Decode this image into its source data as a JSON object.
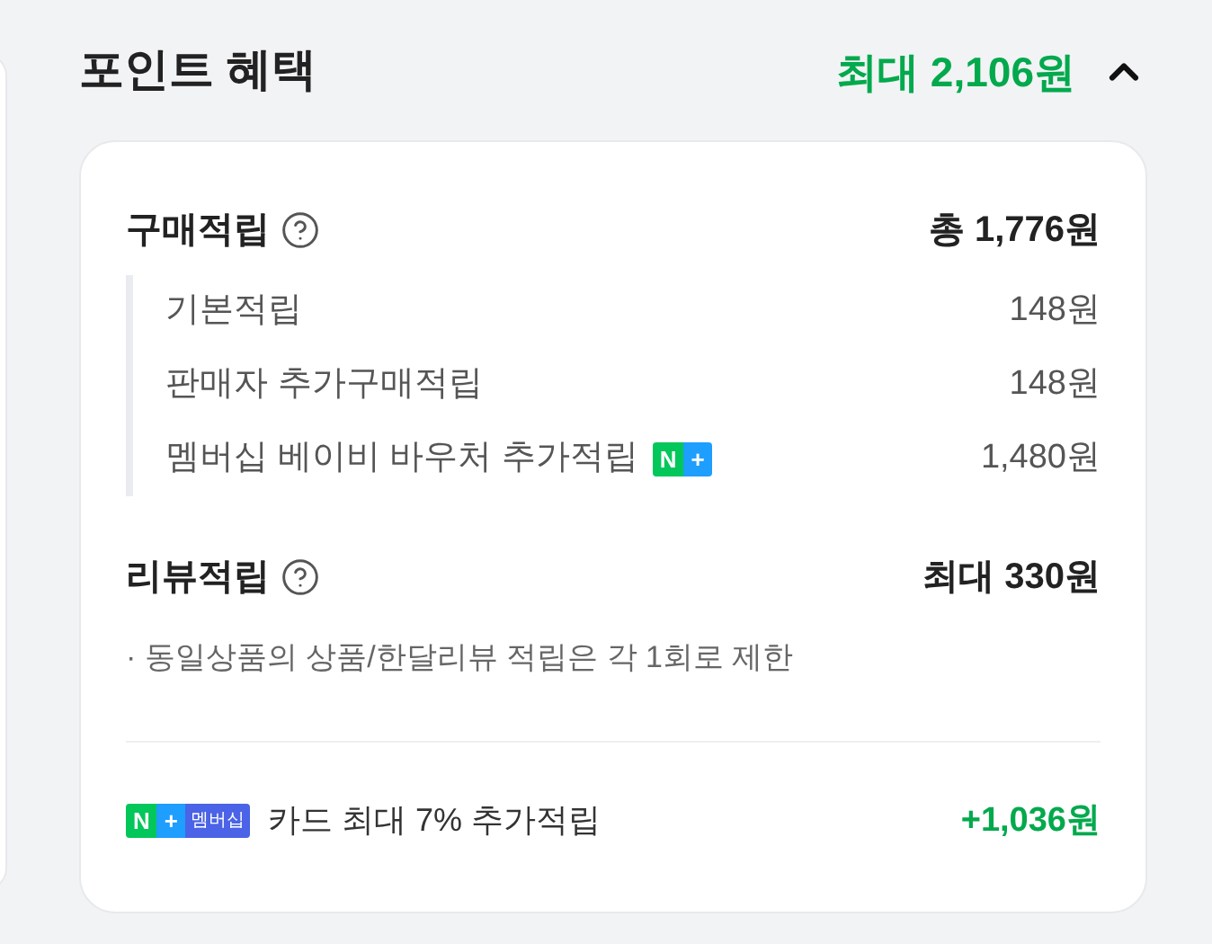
{
  "header": {
    "title": "포인트 혜택",
    "total": "최대 2,106원",
    "expanded": true
  },
  "sections": [
    {
      "title": "구매적립",
      "total": "총 1,776원",
      "items": [
        {
          "label": "기본적립",
          "amount": "148원"
        },
        {
          "label": "판매자 추가구매적립",
          "amount": "148원"
        },
        {
          "label": "멤버십 베이비 바우처 추가적립",
          "amount": "1,480원",
          "badge": {
            "n": "N",
            "plus": "+"
          }
        }
      ]
    },
    {
      "title": "리뷰적립",
      "total": "최대 330원",
      "note": "· 동일상품의 상품/한달리뷰 적립은 각 1회로 제한"
    }
  ],
  "footer": {
    "badge": {
      "n": "N",
      "plus": "+",
      "label": "멤버십"
    },
    "text": "카드 최대 7% 추가적립",
    "amount": "+1,036원"
  }
}
